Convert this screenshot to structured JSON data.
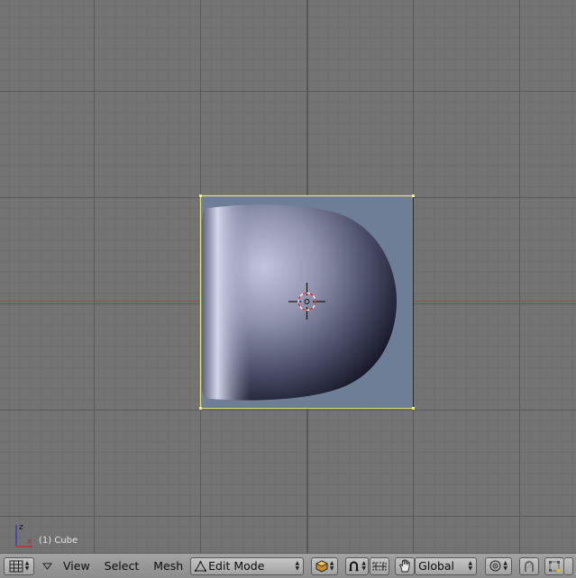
{
  "viewport": {
    "object_label": "(1) Cube",
    "axis_labels": {
      "x": "x",
      "z": "z"
    },
    "colors": {
      "background": "#737373",
      "x_axis": "#b03a3a",
      "y_axis": "#3f4ab0",
      "selection_outline": "#e5e56a",
      "face_fill": "#6e7d95"
    }
  },
  "header": {
    "view_menu": "View",
    "select_menu": "Select",
    "mesh_menu": "Mesh",
    "mode_select": "Edit Mode",
    "orientation_select": "Global",
    "icons": {
      "editor_type": "grid-icon",
      "collapse": "triangle-down-icon",
      "draw_type": "shading-icon",
      "pivot": "pivot-icon",
      "manipulator": "hand-icon",
      "proportional": "proportional-icon",
      "snap": "magnet-icon",
      "select_mode": "vertex-select-icon"
    }
  }
}
